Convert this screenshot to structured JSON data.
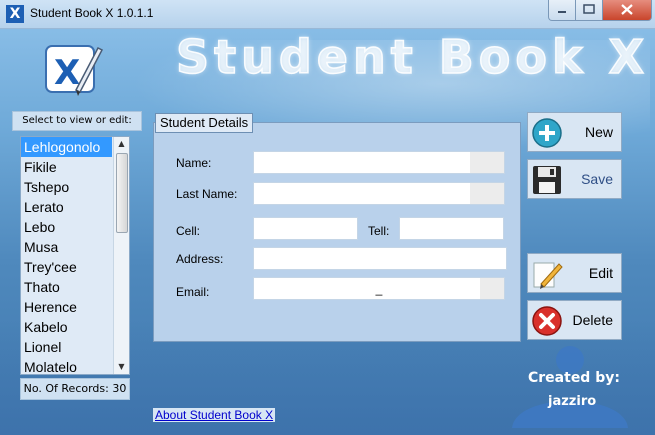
{
  "window": {
    "title": "Student Book X 1.0.1.1",
    "banner": "Student Book X"
  },
  "list": {
    "label": "Select to view or edit:",
    "items": [
      "Lehlogonolo",
      "Fikile",
      "Tshepo",
      "Lerato",
      "Lebo",
      "Musa",
      "Trey'cee",
      "Thato",
      "Herence",
      "Kabelo",
      "Lionel",
      "Molatelo"
    ],
    "selected_index": 0,
    "records_label": "No. Of Records: 30"
  },
  "details": {
    "title": "Student Details",
    "name_label": "Name:",
    "last_name_label": "Last Name:",
    "cell_label": "Cell:",
    "tell_label": "Tell:",
    "address_label": "Address:",
    "email_label": "Email:",
    "email_value": "_"
  },
  "actions": {
    "new": "New",
    "save": "Save",
    "edit": "Edit",
    "delete": "Delete"
  },
  "creator": {
    "line1": "Created by:",
    "line2": "jazziro"
  },
  "about": "About Student Book X",
  "colors": {
    "selected": "#3399ff",
    "link": "#0000cc"
  }
}
